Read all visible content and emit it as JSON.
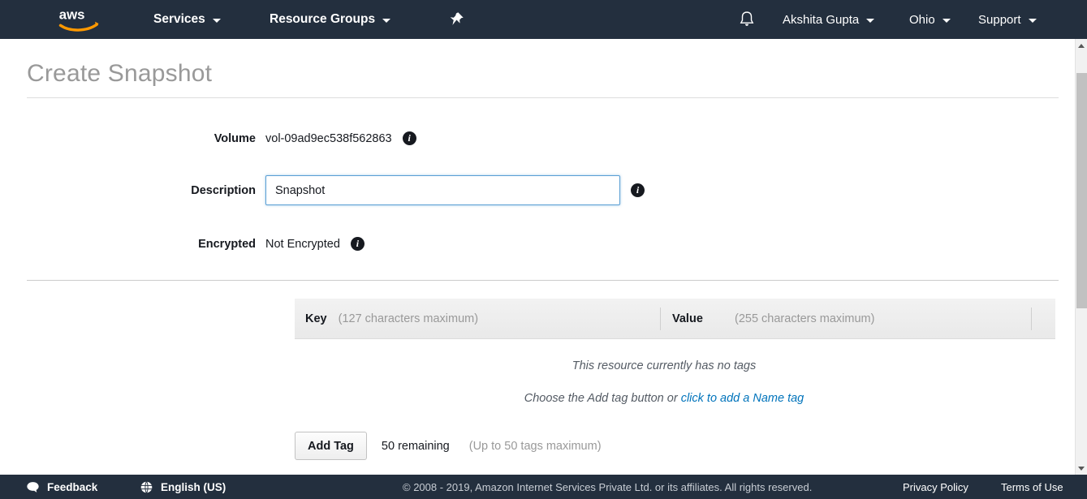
{
  "nav": {
    "logo": "aws-logo",
    "services_label": "Services",
    "resource_groups_label": "Resource Groups",
    "pin_icon": "pin-icon",
    "bell_icon": "bell-icon",
    "user_label": "Akshita Gupta",
    "region_label": "Ohio",
    "support_label": "Support"
  },
  "page": {
    "title": "Create Snapshot"
  },
  "form": {
    "volume_label": "Volume",
    "volume_value": "vol-09ad9ec538f562863",
    "description_label": "Description",
    "description_value": "Snapshot",
    "encrypted_label": "Encrypted",
    "encrypted_value": "Not Encrypted",
    "info_glyph": "i"
  },
  "tags": {
    "key_label": "Key",
    "key_hint": "(127 characters maximum)",
    "value_label": "Value",
    "value_hint": "(255 characters maximum)",
    "empty_message": "This resource currently has no tags",
    "hint_prefix": "Choose the Add tag button or ",
    "name_tag_link": "click to add a Name tag",
    "add_tag_button": "Add Tag",
    "remaining": "50 remaining",
    "max_hint": "(Up to 50 tags maximum)"
  },
  "footer": {
    "feedback_label": "Feedback",
    "language_label": "English (US)",
    "copyright": "© 2008 - 2019, Amazon Internet Services Private Ltd. or its affiliates. All rights reserved.",
    "privacy_label": "Privacy Policy",
    "terms_label": "Terms of Use"
  },
  "colors": {
    "nav_background": "#232f3e",
    "accent_orange": "#ff9900",
    "link_blue": "#0073bb",
    "focus_blue": "#5a9fd4",
    "title_gray": "#999999"
  }
}
